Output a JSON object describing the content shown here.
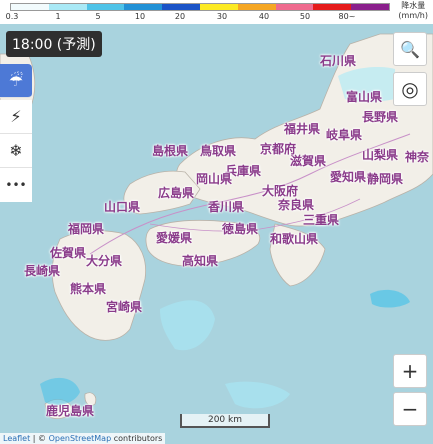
{
  "legend": {
    "ticks": [
      "0.3",
      "1",
      "5",
      "10",
      "20",
      "30",
      "40",
      "50",
      "80~"
    ],
    "colors": [
      "#f2fbfd",
      "#a9e9f6",
      "#4ec3e8",
      "#2191d6",
      "#1a53c7",
      "#fcea22",
      "#f5a623",
      "#ef6a8e",
      "#e51a1a",
      "#8a1f8c"
    ],
    "title_line1": "降水量",
    "title_line2": "(mm/h)"
  },
  "time_label": "18:00 (予測)",
  "sidebar": {
    "items": [
      {
        "name": "rain-icon",
        "glyph": "☔"
      },
      {
        "name": "lightning-icon",
        "glyph": "⚡"
      },
      {
        "name": "snow-icon",
        "glyph": "❄"
      },
      {
        "name": "more-icon",
        "glyph": "•••"
      }
    ]
  },
  "controls": {
    "search": "🔍",
    "locate": "◎",
    "zoom_in": "+",
    "zoom_out": "−"
  },
  "prefectures": [
    "石川県",
    "富山県",
    "長野県",
    "岐阜県",
    "山梨県",
    "神奈",
    "福井県",
    "滋賀県",
    "京都府",
    "愛知県",
    "静岡県",
    "島根県",
    "鳥取県",
    "兵庫県",
    "大阪府",
    "奈良県",
    "三重県",
    "岡山県",
    "広島県",
    "山口県",
    "香川県",
    "徳島県",
    "愛媛県",
    "高知県",
    "福岡県",
    "佐賀県",
    "長崎県",
    "大分県",
    "熊本県",
    "宮崎県",
    "鹿児島県",
    "和歌山県"
  ],
  "scale_label": "200 km",
  "attribution": {
    "leaflet": "Leaflet",
    "sep": "| ©",
    "osm": "OpenStreetMap",
    "contributors": "contributors"
  }
}
